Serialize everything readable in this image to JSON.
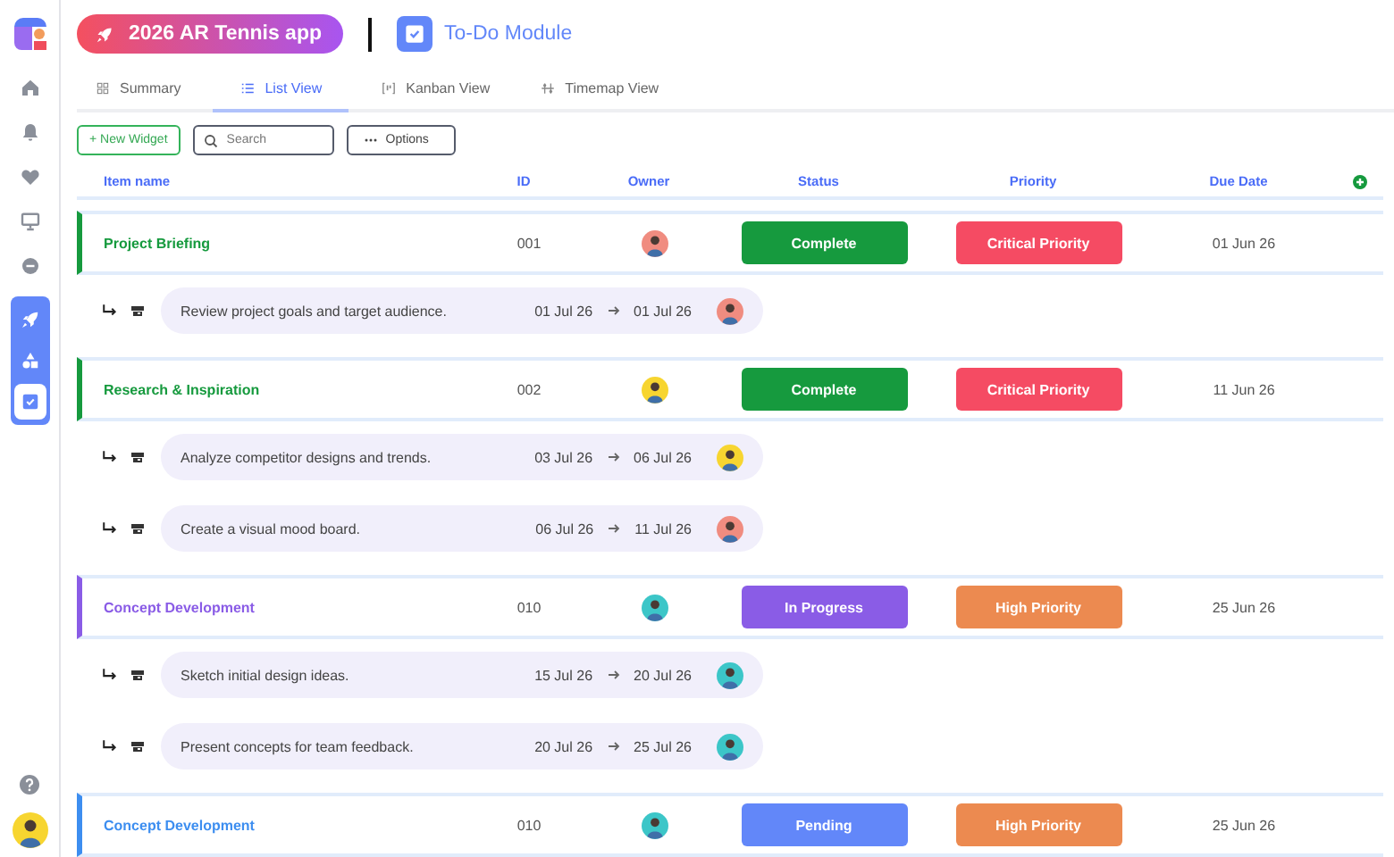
{
  "sidebar": {
    "nav_items": [
      {
        "selected": false
      },
      {
        "selected": false
      },
      {
        "selected": false
      },
      {
        "selected": false
      },
      {
        "selected": false
      }
    ],
    "module_items": [
      {
        "selected": false
      },
      {
        "selected": false
      },
      {
        "selected": true
      }
    ],
    "user": {
      "color": "#f7d530"
    }
  },
  "header": {
    "project": "2026 AR Tennis app",
    "module": "To-Do Module"
  },
  "tabs": [
    {
      "label": "Summary",
      "selected": false
    },
    {
      "label": "List View",
      "selected": true
    },
    {
      "label": "Kanban View",
      "selected": false
    },
    {
      "label": "Timemap View",
      "selected": false
    }
  ],
  "toolbar": {
    "new_widget": "+ New Widget",
    "search": {
      "placeholder": "Search"
    },
    "options": "Options"
  },
  "table": {
    "columns": [
      "Item name",
      "ID",
      "Owner",
      "Status",
      "Priority",
      "Due Date"
    ],
    "rows": [
      {
        "name": "Project Briefing",
        "color": "#169a3e",
        "id": "001",
        "owner": {
          "color": "#f08c80"
        },
        "status": {
          "label": "Complete",
          "color": "#169a3e"
        },
        "priority": {
          "label": "Critical Priority",
          "color": "#f54b63"
        },
        "due": "01 Jun 26",
        "subtasks": [
          {
            "text": "Review project goals and target audience.",
            "start": "01 Jul 26",
            "end": "01 Jul 26",
            "owner": {
              "color": "#f08c80"
            }
          }
        ]
      },
      {
        "name": "Research & Inspiration",
        "color": "#169a3e",
        "id": "002",
        "owner": {
          "color": "#f7d530"
        },
        "status": {
          "label": "Complete",
          "color": "#169a3e"
        },
        "priority": {
          "label": "Critical Priority",
          "color": "#f54b63"
        },
        "due": "11 Jun 26",
        "subtasks": [
          {
            "text": "Analyze competitor designs and trends.",
            "start": "03 Jul 26",
            "end": "06 Jul 26",
            "owner": {
              "color": "#f7d530"
            }
          },
          {
            "text": "Create a visual mood board.",
            "start": "06 Jul 26",
            "end": "11 Jul 26",
            "owner": {
              "color": "#f08c80"
            }
          }
        ]
      },
      {
        "name": "Concept Development",
        "color": "#8a5ce6",
        "id": "010",
        "owner": {
          "color": "#3cc6c8"
        },
        "status": {
          "label": "In Progress",
          "color": "#8a5ce6"
        },
        "priority": {
          "label": "High Priority",
          "color": "#ec8a50"
        },
        "due": "25 Jun 26",
        "subtasks": [
          {
            "text": "Sketch initial design ideas.",
            "start": "15 Jul 26",
            "end": "20 Jul 26",
            "owner": {
              "color": "#3cc6c8"
            }
          },
          {
            "text": "Present concepts for team feedback.",
            "start": "20 Jul 26",
            "end": "25 Jul 26",
            "owner": {
              "color": "#3cc6c8"
            }
          }
        ]
      },
      {
        "name": "Concept Development",
        "color": "#3d8ef0",
        "id": "010",
        "owner": {
          "color": "#3cc6c8"
        },
        "status": {
          "label": "Pending",
          "color": "#6287f9"
        },
        "priority": {
          "label": "High Priority",
          "color": "#ec8a50"
        },
        "due": "25 Jun 26",
        "subtasks": []
      }
    ]
  }
}
